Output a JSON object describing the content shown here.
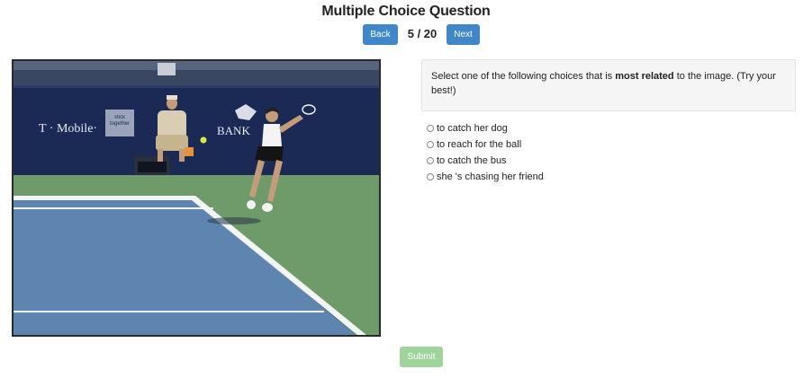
{
  "page": {
    "title": "Multiple Choice Question"
  },
  "nav": {
    "back_label": "Back",
    "counter": "5 / 20",
    "next_label": "Next"
  },
  "prompt": {
    "before": "Select one of the following choices that is ",
    "bold": "most related",
    "after": " to the image. (Try your best!)"
  },
  "image": {
    "ad_text_1": "T · Mobile·",
    "ad_text_2": "stick together",
    "ad_text_3": "BANK"
  },
  "choices": [
    {
      "label": "to catch her dog"
    },
    {
      "label": "to reach for the ball"
    },
    {
      "label": "to catch the bus"
    },
    {
      "label": "she 's chasing her friend"
    }
  ],
  "submit": {
    "label": "Submit"
  },
  "colors": {
    "primary_button": "#3f87c8",
    "submit_button": "#9fd59b"
  }
}
